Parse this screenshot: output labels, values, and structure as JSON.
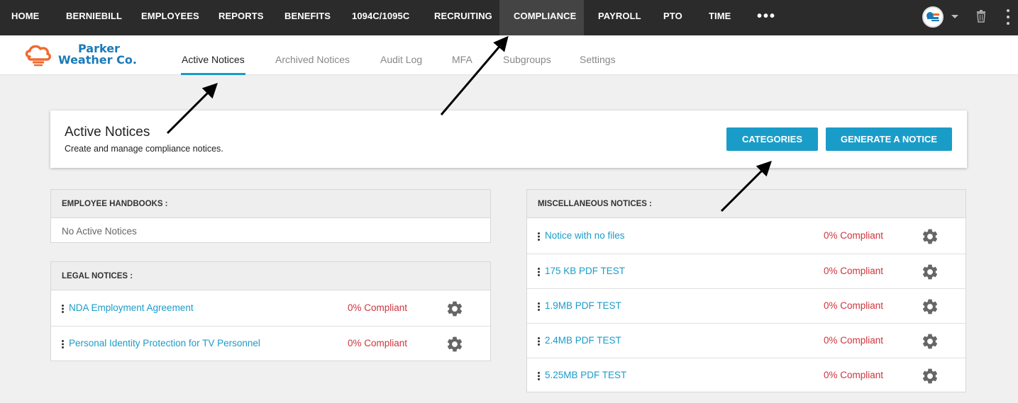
{
  "topnav": {
    "items": [
      {
        "label": "HOME",
        "active": false
      },
      {
        "label": "BERNIEBILL",
        "active": false
      },
      {
        "label": "EMPLOYEES",
        "active": false
      },
      {
        "label": "REPORTS",
        "active": false
      },
      {
        "label": "BENEFITS",
        "active": false
      },
      {
        "label": "1094C/1095C",
        "active": false
      },
      {
        "label": "RECRUITING",
        "active": false
      },
      {
        "label": "COMPLIANCE",
        "active": true
      },
      {
        "label": "PAYROLL",
        "active": false
      },
      {
        "label": "PTO",
        "active": false
      },
      {
        "label": "TIME",
        "active": false
      }
    ],
    "more_label": "•••",
    "icons": {
      "avatar": "company-avatar-icon",
      "caret": "chevron-down-icon",
      "trash": "trash-icon",
      "kebab": "kebab-menu-icon"
    }
  },
  "logo": {
    "line1": "Parker",
    "line2": "Weather Co.",
    "icon": "cloud-logo-icon"
  },
  "subnav": {
    "tabs": [
      {
        "label": "Active Notices",
        "active": true
      },
      {
        "label": "Archived Notices",
        "active": false
      },
      {
        "label": "Audit Log",
        "active": false
      },
      {
        "label": "MFA",
        "active": false
      },
      {
        "label": "Subgroups",
        "active": false
      },
      {
        "label": "Settings",
        "active": false
      }
    ]
  },
  "header": {
    "title": "Active Notices",
    "subtitle": "Create and manage compliance notices.",
    "categories_button": "CATEGORIES",
    "generate_button": "GENERATE A NOTICE"
  },
  "panels": {
    "handbooks": {
      "title": "EMPLOYEE HANDBOOKS :",
      "empty_text": "No Active Notices"
    },
    "legal": {
      "title": "LEGAL NOTICES :",
      "rows": [
        {
          "name": "NDA Employment Agreement",
          "status": "0% Compliant"
        },
        {
          "name": "Personal Identity Protection for TV Personnel",
          "status": "0% Compliant"
        }
      ]
    },
    "misc": {
      "title": "MISCELLANEOUS NOTICES :",
      "rows": [
        {
          "name": "Notice with no files",
          "status": "0% Compliant"
        },
        {
          "name": "175 KB PDF TEST",
          "status": "0% Compliant"
        },
        {
          "name": "1.9MB PDF TEST",
          "status": "0% Compliant"
        },
        {
          "name": "2.4MB PDF TEST",
          "status": "0% Compliant"
        },
        {
          "name": "5.25MB PDF TEST",
          "status": "0% Compliant"
        }
      ]
    }
  },
  "colors": {
    "accent": "#1a9cc9",
    "danger": "#d0343c",
    "nav_bg": "#2b2b2b",
    "logo_blue": "#1a7ab8",
    "logo_orange": "#f26a2e"
  }
}
